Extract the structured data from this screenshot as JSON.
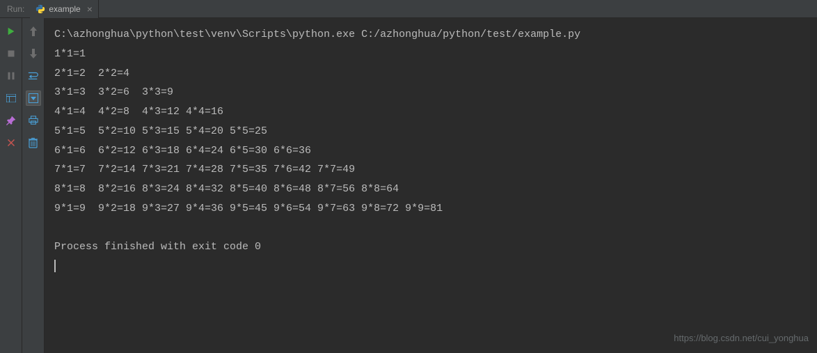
{
  "header": {
    "run_label": "Run:",
    "tab_name": "example",
    "tab_close": "×"
  },
  "console": {
    "cmd": "C:\\azhonghua\\python\\test\\venv\\Scripts\\python.exe C:/azhonghua/python/test/example.py",
    "lines": [
      "1*1=1",
      "2*1=2  2*2=4",
      "3*1=3  3*2=6  3*3=9",
      "4*1=4  4*2=8  4*3=12 4*4=16",
      "5*1=5  5*2=10 5*3=15 5*4=20 5*5=25",
      "6*1=6  6*2=12 6*3=18 6*4=24 6*5=30 6*6=36",
      "7*1=7  7*2=14 7*3=21 7*4=28 7*5=35 7*6=42 7*7=49",
      "8*1=8  8*2=16 8*3=24 8*4=32 8*5=40 8*6=48 8*7=56 8*8=64",
      "9*1=9  9*2=18 9*3=27 9*4=36 9*5=45 9*6=54 9*7=63 9*8=72 9*9=81"
    ],
    "exit": "Process finished with exit code 0"
  },
  "watermark": "https://blog.csdn.net/cui_yonghua"
}
